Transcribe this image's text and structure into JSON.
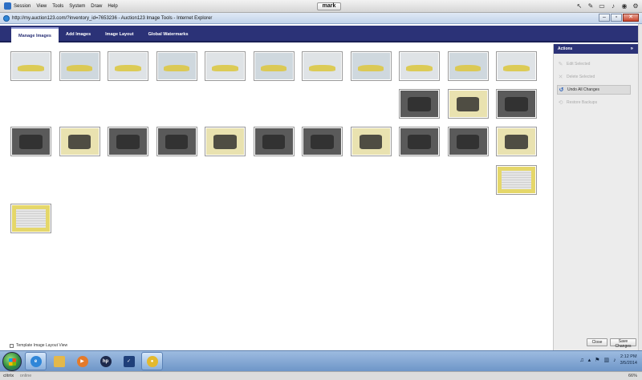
{
  "session": {
    "menu": [
      "Session",
      "View",
      "Tools",
      "System",
      "Draw",
      "Help"
    ],
    "user": "mark",
    "tools": [
      "pointer-icon",
      "pen-icon",
      "monitor-icon",
      "volume-icon",
      "camera-icon",
      "settings-icon"
    ]
  },
  "browser": {
    "title": "http://my.auction123.com/?inventory_id=7653236 - Auction123 Image Tools - Internet Explorer",
    "controls": [
      "minimize",
      "maximize",
      "close"
    ]
  },
  "nav": {
    "tabs": [
      {
        "label": "Manage Images",
        "active": true
      },
      {
        "label": "Add Images",
        "active": false
      },
      {
        "label": "Image Layout",
        "active": false
      },
      {
        "label": "Global Watermarks",
        "active": false
      }
    ]
  },
  "thumbnails": {
    "rows": [
      {
        "count": 11,
        "kind": "car-exterior"
      },
      {
        "count": 3,
        "kind": "interior"
      },
      {
        "count": 11,
        "kind": "interior"
      },
      {
        "count": 1,
        "kind": "window-sticker"
      },
      {
        "count": 1,
        "kind": "window-sticker"
      }
    ],
    "colors": {
      "yellow_car": "#e7d456",
      "interior": "#2e2e2e",
      "frame": "#9a9a9a"
    }
  },
  "template_checkbox": {
    "label": "Template Image Layout View",
    "checked": false
  },
  "actions": {
    "header": "Actions",
    "items": [
      {
        "label": "Edit Selected",
        "enabled": false
      },
      {
        "label": "Delete Selected",
        "enabled": false
      },
      {
        "label": "Undo All Changes",
        "enabled": true
      },
      {
        "label": "Restore Backups",
        "enabled": false
      }
    ],
    "close_label": "Close",
    "save_label": "Save Changes"
  },
  "taskbar": {
    "apps": [
      "ie-icon",
      "explorer-folder-icon",
      "media-player-icon",
      "hp-icon",
      "task-check-icon",
      "auction-app-icon"
    ],
    "time": "2:12 PM",
    "date": "3/5/2014"
  },
  "status": {
    "brand": "citrix",
    "state": "online",
    "zoom": "66%"
  },
  "colors": {
    "nav": "#2b3277",
    "panel": "#ececec",
    "taskbar": "#7fa3d0"
  }
}
